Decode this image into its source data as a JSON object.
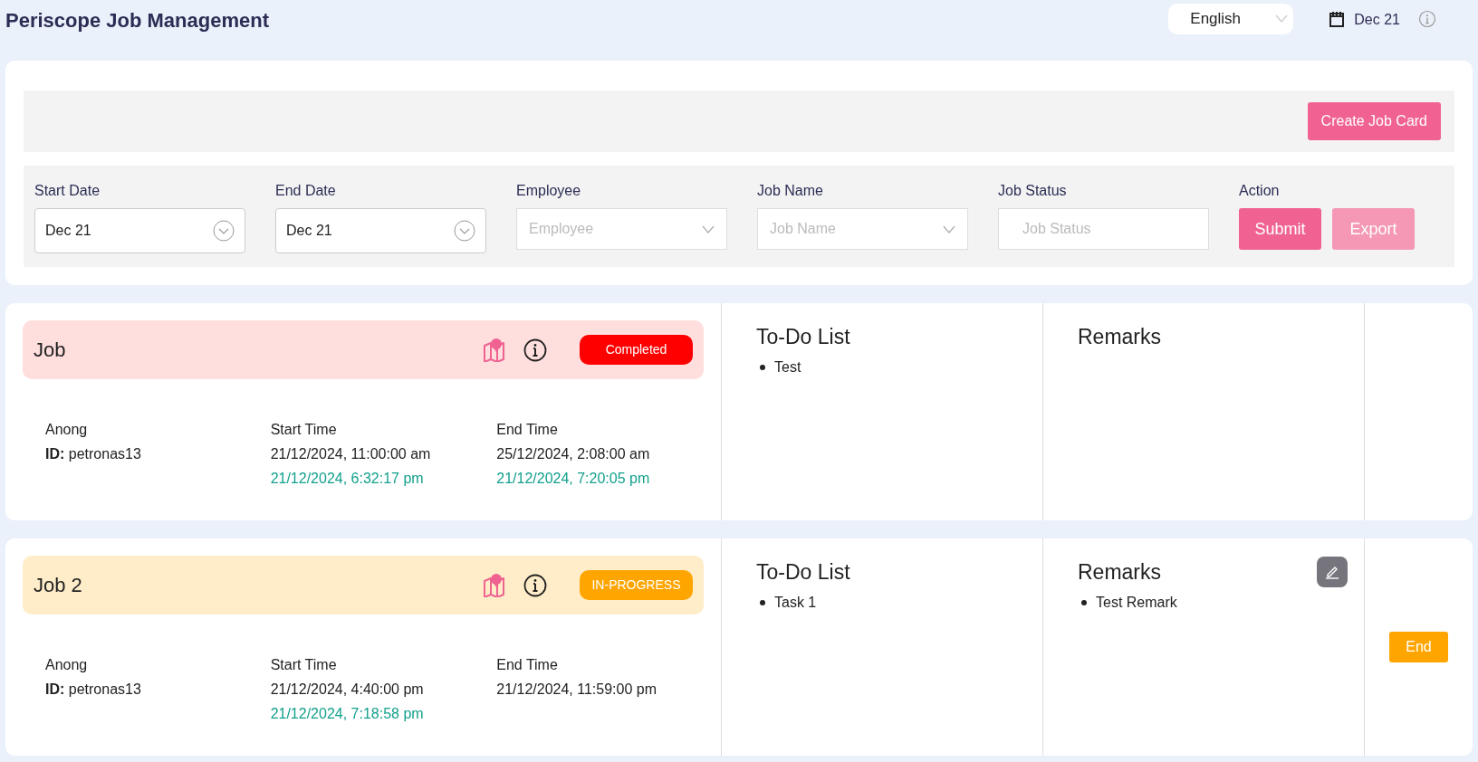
{
  "header": {
    "title": "Periscope Job Management",
    "language": "English",
    "date": "Dec 21"
  },
  "toolbar": {
    "create_button": "Create Job Card"
  },
  "filters": [
    {
      "kind": "date",
      "label": "Start Date",
      "value": "Dec 21"
    },
    {
      "kind": "date",
      "label": "End Date",
      "value": "Dec 21"
    },
    {
      "kind": "select",
      "label": "Employee",
      "placeholder": "Employee"
    },
    {
      "kind": "select",
      "label": "Job Name",
      "placeholder": "Job Name"
    },
    {
      "kind": "text",
      "label": "Job Status",
      "placeholder": "Job Status"
    }
  ],
  "action": {
    "label": "Action",
    "buttons": [
      {
        "label": "Submit",
        "disabled": false
      },
      {
        "label": "Export",
        "disabled": true
      }
    ]
  },
  "jobs": [
    {
      "name": "Job",
      "status": {
        "kind": "completed",
        "label": "Completed"
      },
      "employee": "Anong",
      "id_label": "ID:",
      "id": "petronas13",
      "start_label": "Start Time",
      "start": "21/12/2024, 11:00:00 am",
      "actual_start": "21/12/2024, 6:32:17 pm",
      "end_label": "End Time",
      "end": "25/12/2024, 2:08:00 am",
      "actual_end": "21/12/2024, 7:20:05 pm",
      "todo_title": "To-Do List",
      "todos": [
        "Test"
      ],
      "remarks_title": "Remarks",
      "remarks_editable": false
    },
    {
      "name": "Job 2",
      "status": {
        "kind": "in-progress",
        "label": "IN-PROGRESS"
      },
      "employee": "Anong",
      "id_label": "ID:",
      "id": "petronas13",
      "start_label": "Start Time",
      "start": "21/12/2024, 4:40:00 pm",
      "actual_start": "21/12/2024, 7:18:58 pm",
      "end_label": "End Time",
      "end": "21/12/2024, 11:59:00 pm",
      "todo_title": "To-Do List",
      "todos": [
        "Task 1"
      ],
      "remarks_title": "Remarks",
      "remarks_editable": true,
      "remarks": [
        "Test Remark"
      ],
      "end_button": "End"
    }
  ]
}
